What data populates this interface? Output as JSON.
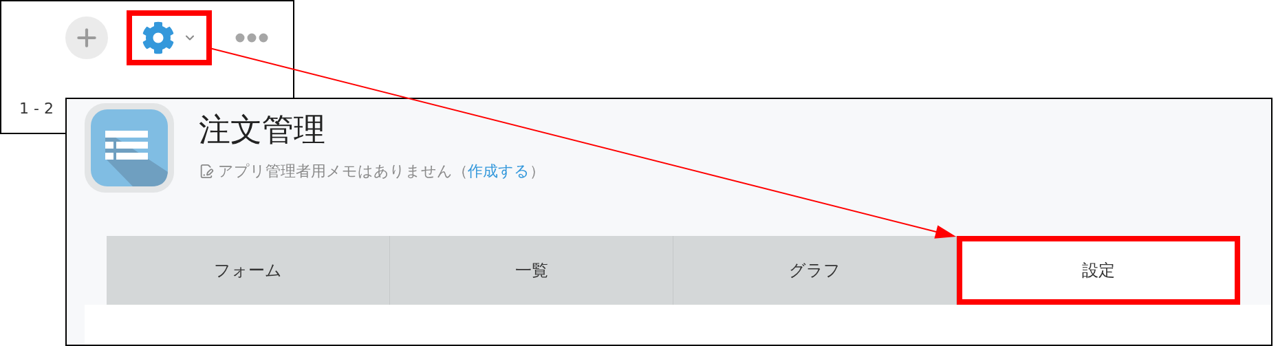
{
  "toolbar": {
    "buttons": [
      {
        "kind": "add",
        "highlighted": false
      },
      {
        "kind": "settings",
        "highlighted": true
      },
      {
        "kind": "more",
        "highlighted": false
      }
    ],
    "record_range": "1 - 2"
  },
  "app": {
    "title": "注文管理",
    "memo": {
      "text": "アプリ管理者用メモはありません（",
      "link": "作成する",
      "after": "）"
    },
    "tabs": [
      {
        "label": "フォーム",
        "selected": false,
        "highlighted": false
      },
      {
        "label": "一覧",
        "selected": false,
        "highlighted": false
      },
      {
        "label": "グラフ",
        "selected": false,
        "highlighted": false
      },
      {
        "label": "設定",
        "selected": true,
        "highlighted": true
      }
    ]
  },
  "callout_arrow": true
}
